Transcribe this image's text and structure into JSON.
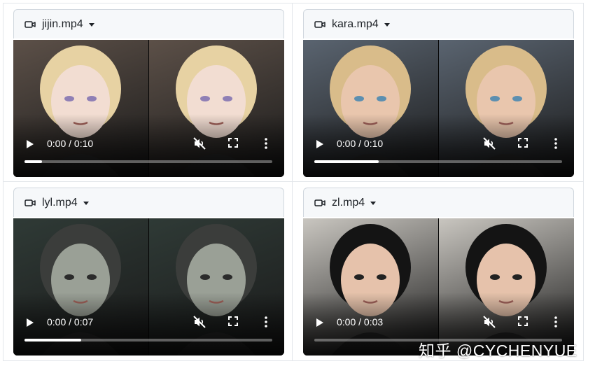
{
  "videos": [
    {
      "file_name": "jijin.mp4",
      "time": "0:00 / 0:10",
      "progress": 0.07,
      "palette": {
        "bg": "#5c5048",
        "hair": "#e7d2a3",
        "skin": "#f2ddd2",
        "eye": "#8f7fb5"
      }
    },
    {
      "file_name": "kara.mp4",
      "time": "0:00 / 0:10",
      "progress": 0.26,
      "palette": {
        "bg": "#5a6470",
        "hair": "#d9bc8a",
        "skin": "#e9c6ad",
        "eye": "#5c8fb0"
      }
    },
    {
      "file_name": "lyl.mp4",
      "time": "0:00 / 0:07",
      "progress": 0.23,
      "palette": {
        "bg": "#2f3a36",
        "hair": "#3b3d3b",
        "skin": "#9aa096",
        "eye": "#2b2b2b"
      }
    },
    {
      "file_name": "zl.mp4",
      "time": "0:00 / 0:03",
      "progress": 0.0,
      "palette": {
        "bg": "#c9c6c0",
        "hair": "#141414",
        "skin": "#e6c2ab",
        "eye": "#222222"
      }
    }
  ],
  "watermark": "知乎 @CYCHENYUE"
}
